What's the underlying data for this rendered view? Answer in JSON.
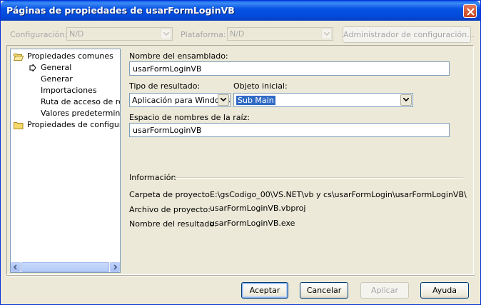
{
  "window": {
    "title": "Páginas de propiedades de usarFormLoginVB"
  },
  "topbar": {
    "configuracion_label": "Configuración:",
    "configuracion_value": "N/D",
    "plataforma_label": "Plataforma:",
    "plataforma_value": "N/D",
    "admin_button": "Administrador de configuración..."
  },
  "tree": {
    "items": [
      {
        "label": "Propiedades comunes",
        "kind": "folder-open"
      },
      {
        "label": "General",
        "kind": "selected-arrow"
      },
      {
        "label": "Generar",
        "kind": "child"
      },
      {
        "label": "Importaciones",
        "kind": "child"
      },
      {
        "label": "Ruta de acceso de refe",
        "kind": "child"
      },
      {
        "label": "Valores predeterminado",
        "kind": "child"
      },
      {
        "label": "Propiedades de configuraci",
        "kind": "folder"
      }
    ]
  },
  "form": {
    "assembly_label": "Nombre del ensamblado:",
    "assembly_value": "usarFormLoginVB",
    "output_type_label": "Tipo de resultado:",
    "output_type_value": "Aplicación para Windows",
    "startup_label": "Objeto inicial:",
    "startup_value": "Sub Main",
    "root_ns_label": "Espacio de nombres de la raíz:",
    "root_ns_value": "usarFormLoginVB"
  },
  "info": {
    "section_title": "Información",
    "rows": [
      {
        "label": "Carpeta de proyecto:",
        "value": "E:\\gsCodigo_00\\VS.NET\\vb y cs\\usarFormLogin\\usarFormLoginVB\\"
      },
      {
        "label": "Archivo de proyecto:",
        "value": "usarFormLoginVB.vbproj"
      },
      {
        "label": "Nombre del resultado:",
        "value": "usarFormLoginVB.exe"
      }
    ]
  },
  "buttons": {
    "ok": "Aceptar",
    "cancel": "Cancelar",
    "apply": "Aplicar",
    "help": "Ayuda"
  },
  "colors": {
    "titlebar": "#0753e4",
    "dialog_bg": "#ece9d8",
    "selection": "#316ac5"
  }
}
